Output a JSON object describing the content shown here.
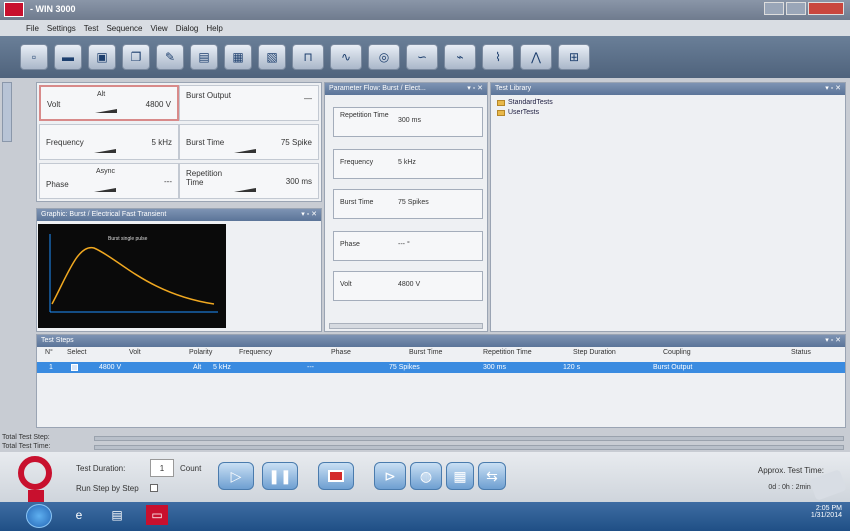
{
  "window": {
    "title": "- WIN 3000"
  },
  "menu": [
    "File",
    "Settings",
    "Test",
    "Sequence",
    "View",
    "Dialog",
    "Help"
  ],
  "parameters": {
    "cells": [
      {
        "label": "Volt",
        "sub": "Alt",
        "value": "4800 V"
      },
      {
        "label": "Burst Output",
        "value": "—"
      },
      {
        "label": "Frequency",
        "value": "5 kHz"
      },
      {
        "label": "Burst Time",
        "value": "75 Spike"
      },
      {
        "label": "Phase",
        "sub": "Async",
        "value": "---"
      },
      {
        "label": "Repetition Time",
        "value": "300 ms"
      }
    ]
  },
  "graphic": {
    "header": "Graphic: Burst / Electrical Fast Transient",
    "plot_title": "Burst single pulse"
  },
  "flow": {
    "header": "Parameter Flow: Burst / Elect...",
    "items": [
      {
        "label": "Repetition Time",
        "value": "300 ms"
      },
      {
        "label": "Frequency",
        "value": "5 kHz"
      },
      {
        "label": "Burst Time",
        "value": "75 Spikes"
      },
      {
        "label": "Phase",
        "value": "--- °"
      },
      {
        "label": "Volt",
        "value": "4800 V"
      }
    ]
  },
  "library": {
    "header": "Test Library",
    "items": [
      "StandardTests",
      "UserTests"
    ]
  },
  "steps": {
    "header": "Test Steps",
    "columns": [
      "N°",
      "Select",
      "Volt",
      "Polarity",
      "Frequency",
      "Phase",
      "Burst Time",
      "Repetition Time",
      "Step Duration",
      "Coupling",
      "Status"
    ],
    "rows": [
      {
        "n": "1",
        "volt": "4800 V",
        "polarity": "Alt",
        "frequency": "5 kHz",
        "phase": "---",
        "burst": "75 Spikes",
        "rep": "300 ms",
        "duration": "120 s",
        "coupling": "Burst Output",
        "status": ""
      }
    ]
  },
  "totals": {
    "step": "Total Test Step:",
    "time": "Total Test Time:"
  },
  "run": {
    "duration_label": "Test Duration:",
    "count_value": "1",
    "count_label": "Count",
    "step_by_step": "Run Step by Step",
    "approx_label": "Approx. Test Time:",
    "approx_value": "0d : 0h : 2min : 0s"
  },
  "taskbar": {
    "time": "2:05 PM",
    "date": "1/31/2014"
  }
}
